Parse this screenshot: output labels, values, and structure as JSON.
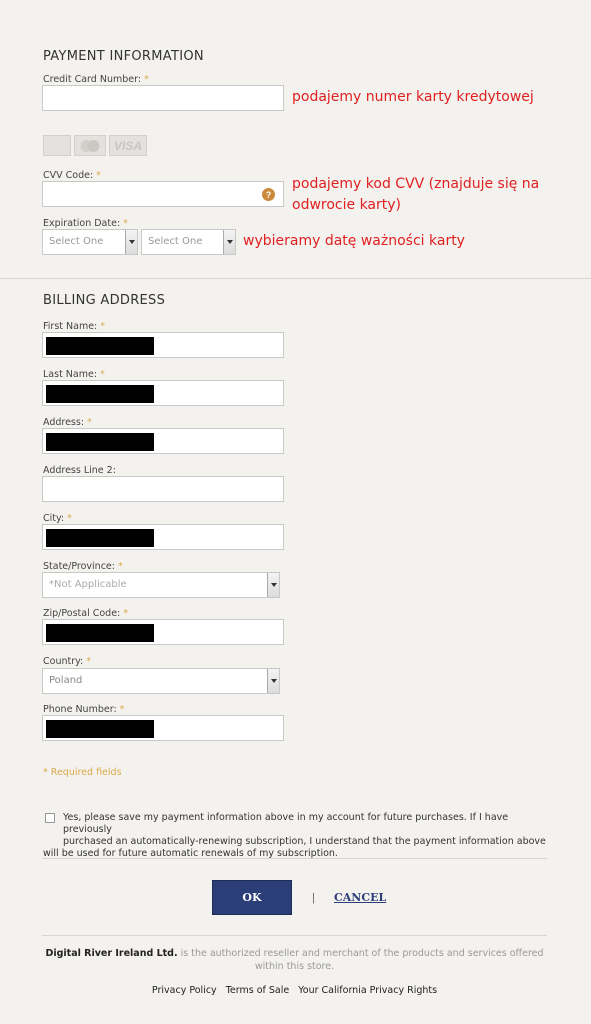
{
  "payment": {
    "title": "PAYMENT INFORMATION",
    "card_number_label": "Credit Card Number:",
    "card_number_annotation": "podajemy numer karty kredytowej",
    "card_logos": [
      "",
      "",
      "VISA"
    ],
    "cvv_label": "CVV Code:",
    "cvv_help": "?",
    "cvv_annotation_line1": "podajemy kod CVV (znajduje się na",
    "cvv_annotation_line2": "odwrocie karty)",
    "expiry_label": "Expiration Date:",
    "expiry_month": "Select One",
    "expiry_year": "Select One",
    "expiry_annotation": "wybieramy datę ważności karty"
  },
  "required_marker": "*",
  "billing": {
    "title": "BILLING ADDRESS",
    "first_name_label": "First Name:",
    "last_name_label": "Last Name:",
    "address_label": "Address:",
    "address2_label": "Address Line 2:",
    "city_label": "City:",
    "state_label": "State/Province:",
    "state_value": "*Not Applicable",
    "zip_label": "Zip/Postal Code:",
    "country_label": "Country:",
    "country_value": "Poland",
    "phone_label": "Phone Number:"
  },
  "required_note": "* Required fields",
  "save_text_line1": "Yes, please save my payment information above in my account for future purchases. If I have previously",
  "save_text_line2": "purchased an automatically-renewing subscription, I understand that the payment information above",
  "save_text_line3": "will be used for future automatic renewals of my subscription.",
  "actions": {
    "ok": "OK",
    "separator": "|",
    "cancel": "CANCEL"
  },
  "footer": {
    "company": "Digital River Ireland Ltd.",
    "reseller_line1": "is the authorized reseller and merchant of the products and services offered",
    "reseller_line2": "within this store.",
    "links": [
      "Privacy Policy",
      "Terms of Sale",
      "Your California Privacy Rights"
    ]
  },
  "colors": {
    "annotation": "#e02020",
    "required": "#d9a94a",
    "button": "#2c3e78",
    "link": "#2c3e78"
  }
}
